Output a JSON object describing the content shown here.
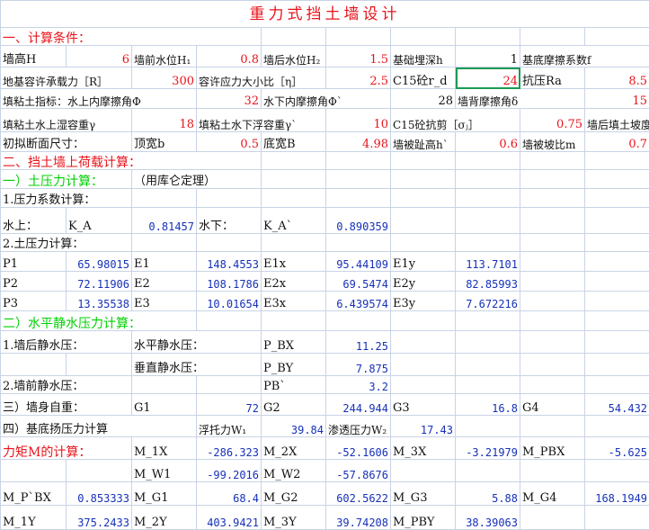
{
  "title": "重力式挡土墙设计",
  "sec1": "一、计算条件：",
  "r3": [
    "墙高H",
    "6",
    "墙前水位H₁",
    "0.8",
    "墙后水位H₂",
    "1.5",
    "基础埋深h",
    "1",
    "基底摩擦系数f",
    ""
  ],
  "r4": [
    "地基容许承载力［R］",
    "300",
    "容许应力大小比［η］",
    "2.5",
    "C15砼r_d",
    "24",
    "抗压Ra",
    "8.5"
  ],
  "r5": [
    "填粘土指标：水上内摩擦角Φ",
    "32",
    "水下内摩擦角Φ`",
    "28",
    "墙背摩擦角δ",
    "15"
  ],
  "r6": [
    "填粘土水上湿容重γ",
    "18",
    "填粘土水下浮容重γ`",
    "10",
    "C15砼抗剪［σⱼ］",
    "0.75",
    "墙后填土坡度"
  ],
  "r7": [
    "初拟断面尺寸：",
    "顶宽b",
    "0.5",
    "底宽B",
    "4.98",
    "墙被趾高h`",
    "0.6",
    "墙被坡比m",
    "0.7"
  ],
  "sec2": "二、挡土墙上荷载计算：",
  "sub1": "一）土压力计算：",
  "sub1_note": "（用库仑定理）",
  "coef_title": "1.压力系数计算：",
  "coef": [
    "水上：",
    "K_A",
    "0.81457",
    "水下：",
    "K_A`",
    "0.890359"
  ],
  "force_title": "2.土压力计算：",
  "forces": [
    [
      "P1",
      "65.98015",
      "E1",
      "148.4553",
      "E1x",
      "95.44109",
      "E1y",
      "113.7101"
    ],
    [
      "P2",
      "72.11906",
      "E2",
      "108.1786",
      "E2x",
      "69.5474",
      "E2y",
      "82.85993"
    ],
    [
      "P3",
      "13.35538",
      "E3",
      "10.01654",
      "E3x",
      "6.439574",
      "E3y",
      "7.672216"
    ]
  ],
  "sub2": "二）水平静水压力计算：",
  "hyd1": [
    "1.墙后静水压：",
    "水平静水压：",
    "P_BX",
    "11.25"
  ],
  "hyd2": [
    "垂直静水压：",
    "P_BY",
    "7.875"
  ],
  "hyd3": [
    "2.墙前静水压：",
    "PB`",
    "3.2"
  ],
  "selfw": [
    "三）墙身自重：",
    "G1",
    "72",
    "G2",
    "244.944",
    "G3",
    "16.8",
    "G4",
    "54.432"
  ],
  "uplift": [
    "四）基底扬压力计算",
    "浮托力W₁",
    "39.84",
    "渗透压力W₂",
    "17.43"
  ],
  "mom1": [
    "力矩M的计算：",
    "M_1X",
    "-286.323",
    "M_2X",
    "-52.1606",
    "M_3X",
    "-3.21979",
    "M_PBX",
    "-5.625"
  ],
  "mom2": [
    "M_W1",
    "-99.2016",
    "M_W2",
    "-57.8676"
  ],
  "mom3": [
    "M_P`BX",
    "0.853333",
    "M_G1",
    "68.4",
    "M_G2",
    "602.5622",
    "M_G3",
    "5.88",
    "M_G4",
    "168.1949"
  ],
  "mom4": [
    "M_1Y",
    "375.2433",
    "M_2Y",
    "403.9421",
    "M_3Y",
    "39.74208",
    "M_PBY",
    "38.39063"
  ]
}
